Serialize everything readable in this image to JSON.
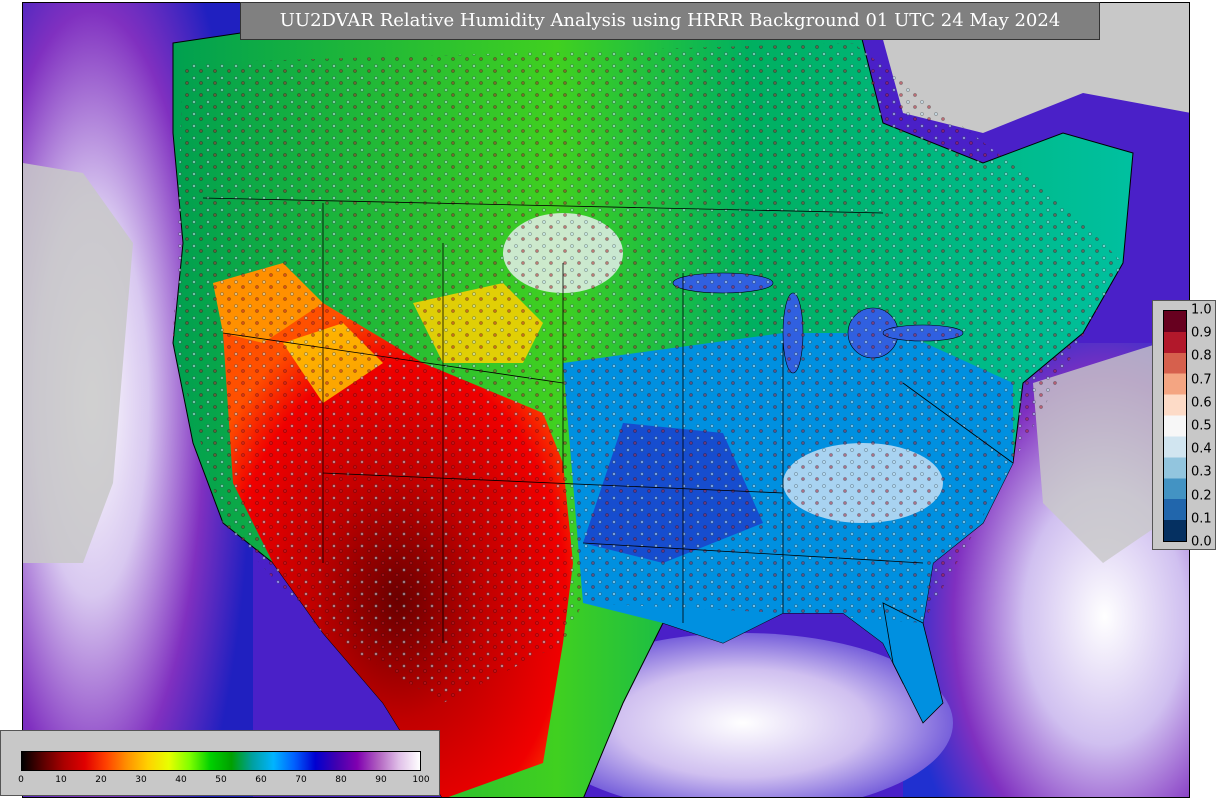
{
  "title": "UU2DVAR Relative Humidity Analysis using HRRR Background 01 UTC 24 May 2024",
  "main_legend": {
    "ticks": [
      "0",
      "10",
      "20",
      "30",
      "40",
      "50",
      "60",
      "70",
      "80",
      "90",
      "100"
    ],
    "colors": [
      "#000000",
      "#5a0000",
      "#aa0000",
      "#e00000",
      "#ff4000",
      "#ff9000",
      "#ffd000",
      "#e8ff00",
      "#80ff00",
      "#00d000",
      "#00a000",
      "#00a0a0",
      "#00b4ff",
      "#0060ff",
      "#0000d0",
      "#4000b0",
      "#8000b0",
      "#b060c0",
      "#e0c0e8",
      "#ffffff"
    ]
  },
  "side_legend": {
    "ticks": [
      "1.0",
      "0.9",
      "0.8",
      "0.7",
      "0.6",
      "0.5",
      "0.4",
      "0.3",
      "0.2",
      "0.1",
      "0.0"
    ],
    "colors": [
      "#67001f",
      "#b2182b",
      "#d6604d",
      "#f4a582",
      "#fddbc7",
      "#f7f7f7",
      "#d1e5f0",
      "#92c5de",
      "#4393c3",
      "#2166ac",
      "#053061"
    ]
  },
  "map_colors": {
    "ocean_moist": "#4a20c8",
    "ocean_dry": "#c8c8c8",
    "land_arid": "#e00000",
    "land_very_arid": "#700000",
    "land_moist": "#00c040",
    "land_humid": "#0090e0",
    "land_wet": "#2020c0"
  }
}
